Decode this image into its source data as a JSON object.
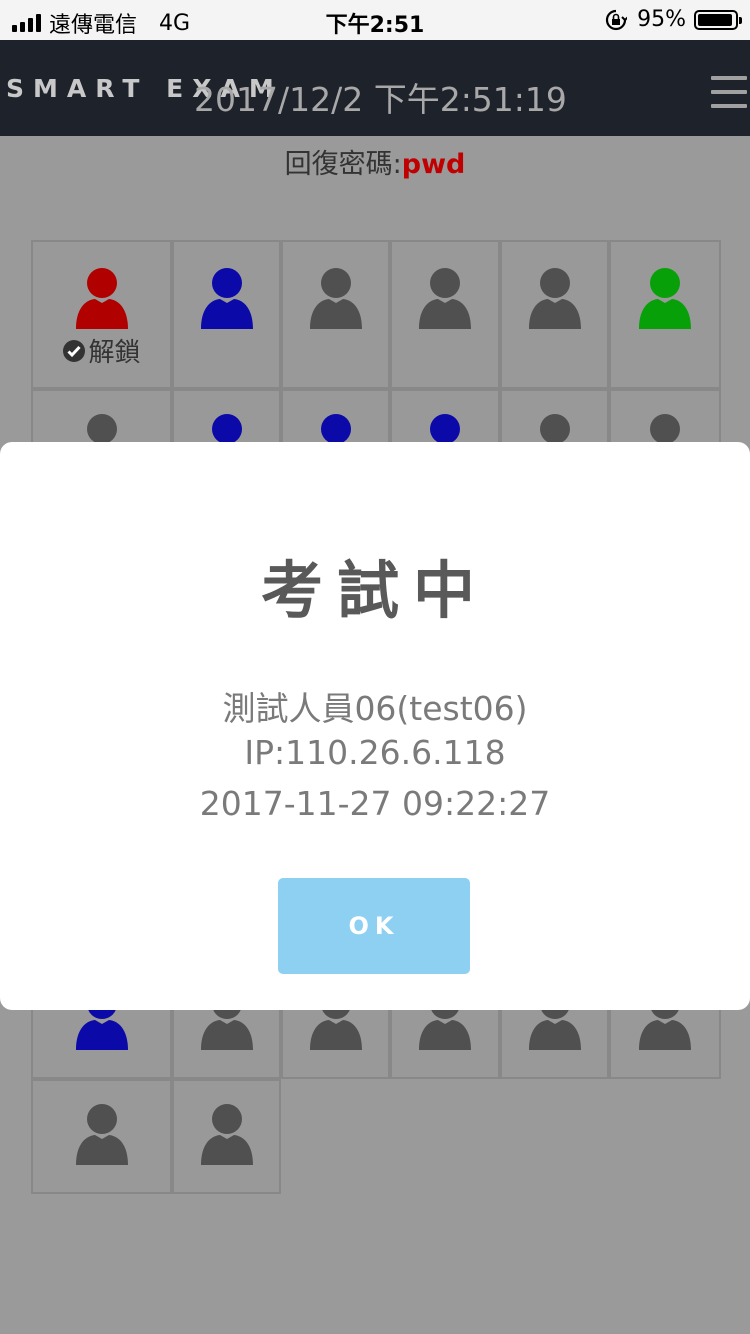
{
  "status_bar": {
    "carrier": "遠傳電信",
    "network": "4G",
    "time": "下午2:51",
    "battery": "95%",
    "battery_fraction": 0.95
  },
  "nav": {
    "brand": "SMART EXAM",
    "datetime": "2017/12/2 下午2:51:19"
  },
  "recovery": {
    "label": "回復密碼:",
    "password": "pwd"
  },
  "colors": {
    "red": "#b00000",
    "blue": "#0b0aa8",
    "gray": "#505050",
    "green": "#08a008",
    "ok_button": "#8dd0f2"
  },
  "unlock_label": "解鎖",
  "seats": [
    "red",
    "blue",
    "gray",
    "gray",
    "gray",
    "green",
    "gray",
    "blue",
    "blue",
    "blue",
    "gray",
    "gray",
    "gray",
    "gray",
    "gray",
    "gray",
    "gray",
    "gray",
    "gray",
    "gray",
    "gray",
    "gray",
    "gray",
    "gray",
    "gray",
    "gray",
    "gray",
    "gray",
    "gray",
    "gray",
    "gray",
    "gray",
    "gray",
    "gray",
    "gray",
    "gray",
    "blue",
    "gray",
    "gray",
    "gray",
    "gray",
    "gray",
    "gray",
    "gray"
  ],
  "modal": {
    "title": "考試中",
    "user": "測試人員06(test06)",
    "ip": "IP:110.26.6.118",
    "datetime": "2017-11-27 09:22:27",
    "ok": "OK"
  }
}
